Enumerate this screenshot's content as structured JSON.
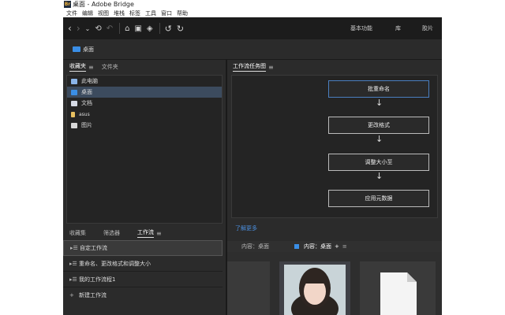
{
  "window": {
    "title": "桌面 - Adobe Bridge",
    "app_icon_text": "Br"
  },
  "menu": [
    "文件",
    "编辑",
    "视图",
    "堆栈",
    "标签",
    "工具",
    "窗口",
    "帮助"
  ],
  "workspaces": [
    "基本功能",
    "库",
    "胶片"
  ],
  "path": {
    "label": "桌面"
  },
  "left_tabs": {
    "favorites": "收藏夹",
    "folders": "文件夹"
  },
  "favorites": [
    {
      "label": "此电脑",
      "icon": "computer-icon",
      "color": "#8ab4e8"
    },
    {
      "label": "桌面",
      "icon": "desktop-folder-icon",
      "color": "#3a8ee6"
    },
    {
      "label": "文档",
      "icon": "documents-icon",
      "color": "#d6dbe6"
    },
    {
      "label": "asus",
      "icon": "user-folder-icon",
      "color": "#e8c060"
    },
    {
      "label": "图片",
      "icon": "pictures-icon",
      "color": "#d8d8d8"
    }
  ],
  "workflow_panel": {
    "title": "工作流任务图",
    "steps": [
      "批重命名",
      "更改格式",
      "调整大小至",
      "应用元数据"
    ],
    "learn_more": "了解更多"
  },
  "bottom_tabs": {
    "favorites": "收藏集",
    "filter": "筛选器",
    "workflow": "工作流"
  },
  "workflows": [
    {
      "label": "自定工作流",
      "icon": "workflow-icon"
    },
    {
      "label": "重命名、更改格式和调整大小",
      "icon": "workflow-icon"
    },
    {
      "label": "我的工作流程1",
      "icon": "workflow-icon"
    }
  ],
  "new_workflow": {
    "label": "新建工作流",
    "symbol": "+"
  },
  "content_tabs": {
    "tab1": "内容：桌面",
    "tab2": "内容：桌面",
    "add": "+"
  },
  "colors": {
    "accent": "#3a8ee6",
    "link": "#4b8fdf",
    "selection": "#3c4b5e"
  }
}
